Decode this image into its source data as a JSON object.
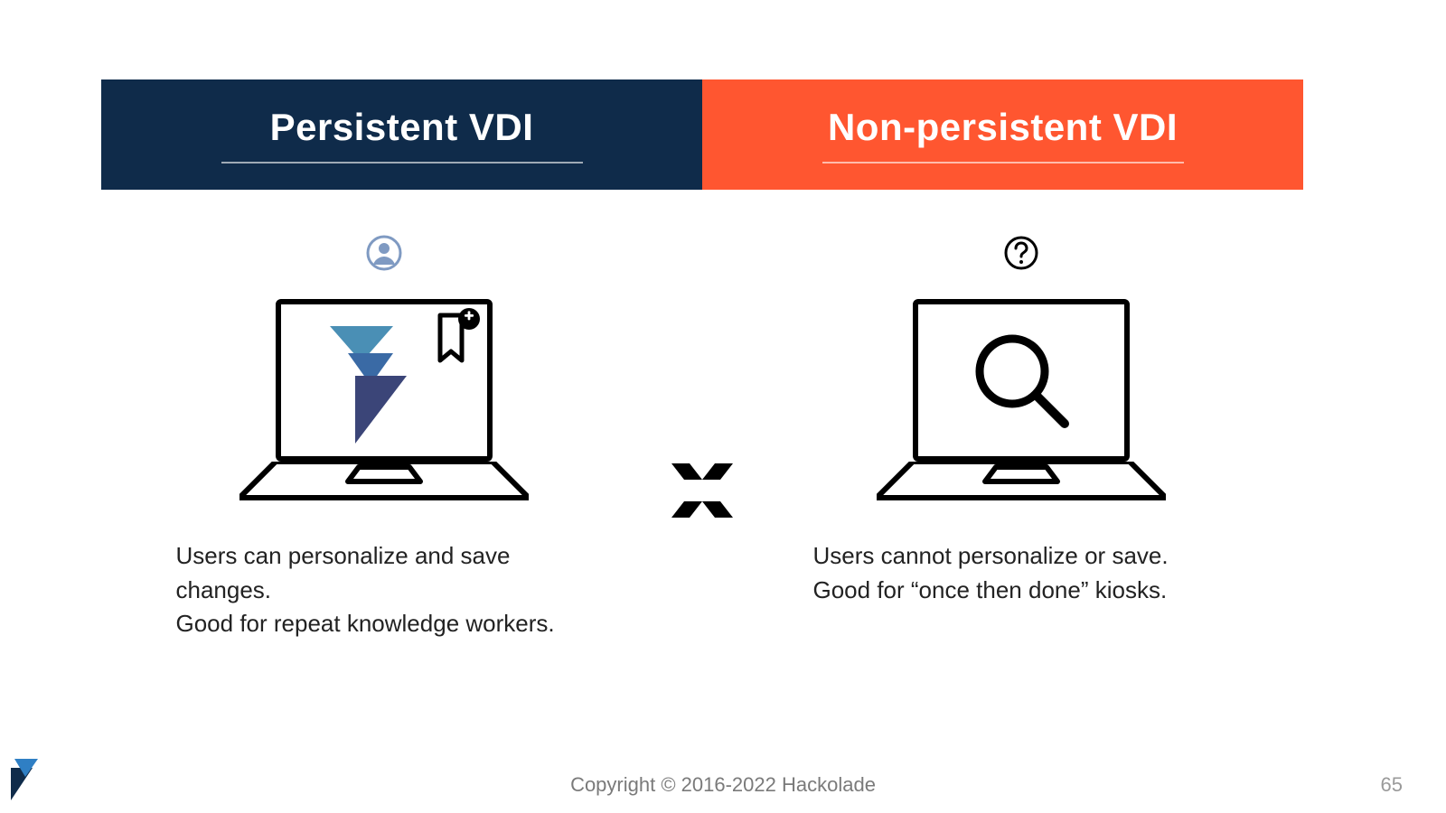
{
  "header": {
    "left_title": "Persistent VDI",
    "right_title": "Non-persistent VDI"
  },
  "left_col": {
    "line1": "Users  can personalize and save changes.",
    "line2": "Good for repeat knowledge workers."
  },
  "right_col": {
    "line1": "Users  cannot personalize or save.",
    "line2": "Good for “once then done” kiosks."
  },
  "footer": {
    "copyright": "Copyright © 2016-2022 Hackolade",
    "page": "65"
  },
  "colors": {
    "navy": "#0f2b4a",
    "orange": "#ff5630",
    "logo_light_blue": "#4a8fb5",
    "logo_mid_blue": "#3a6aa5",
    "logo_dark_blue": "#3b4578"
  }
}
